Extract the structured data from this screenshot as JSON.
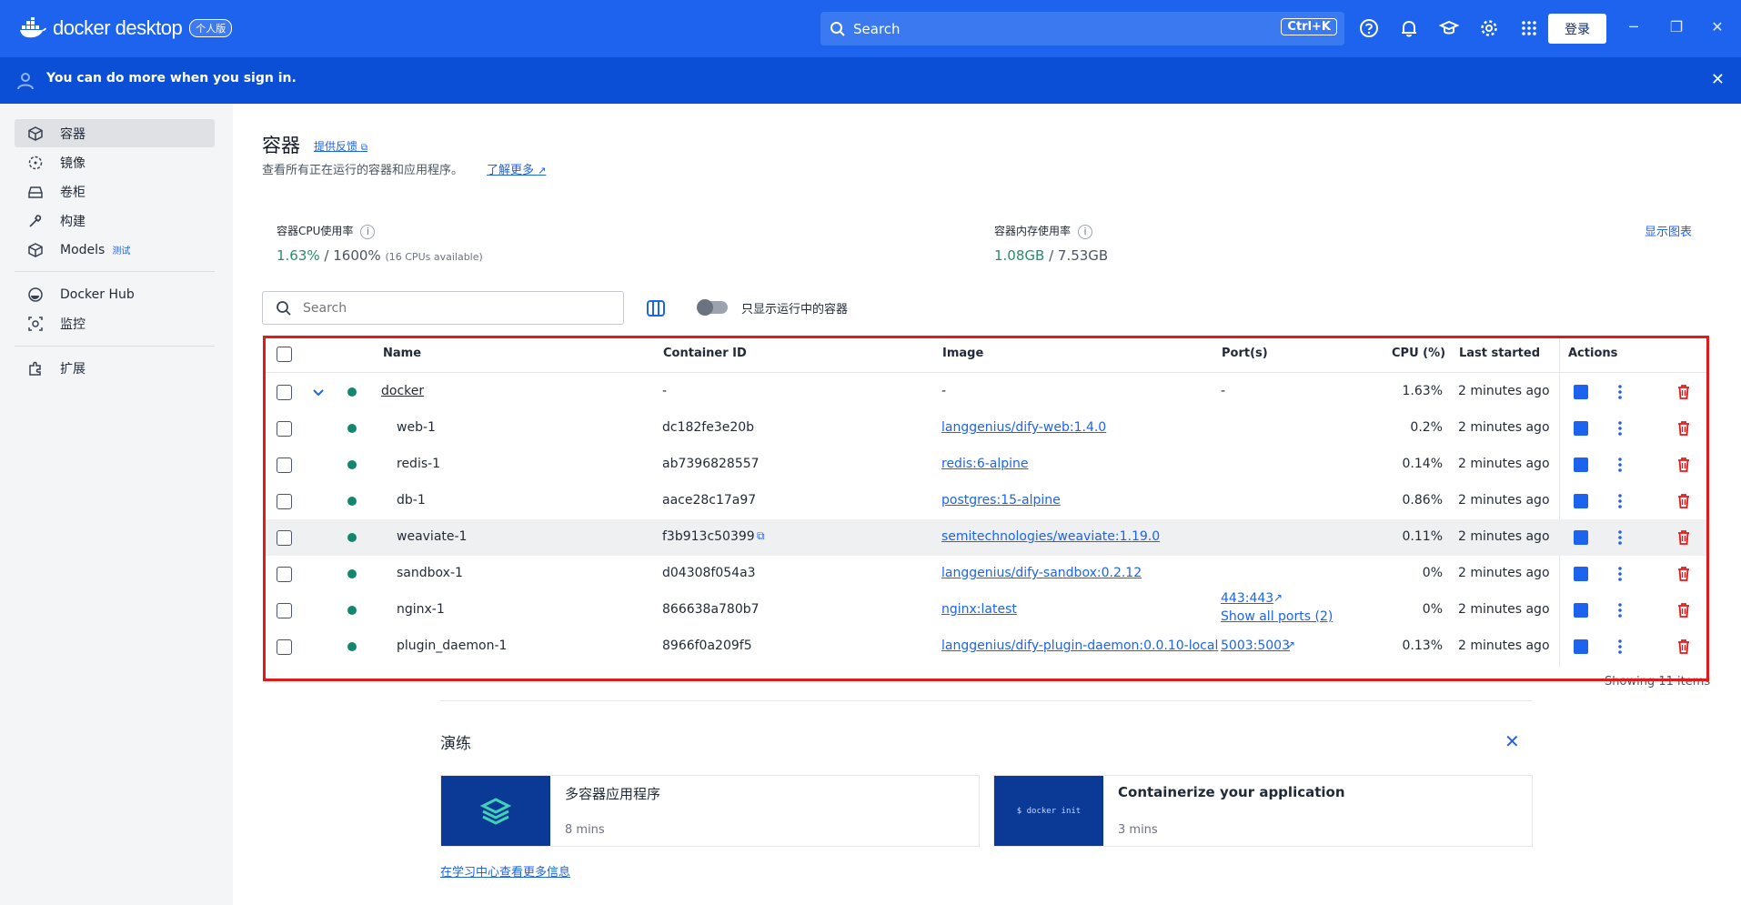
{
  "app": {
    "brand": "docker desktop",
    "edition_badge": "个人版",
    "search_label": "Search",
    "search_shortcut": "Ctrl+K",
    "login_label": "登录",
    "accent_color": "#1d63ed"
  },
  "banner": {
    "text": "You can do more when you sign in.",
    "close_label": "✕"
  },
  "sidebar": {
    "items": [
      {
        "label": "容器",
        "icon": "container-icon",
        "active": true
      },
      {
        "label": "镜像",
        "icon": "images-icon"
      },
      {
        "label": "卷柜",
        "icon": "volumes-icon"
      },
      {
        "label": "构建",
        "icon": "builds-icon"
      },
      {
        "label": "Models",
        "icon": "models-icon",
        "badge": "测试"
      },
      {
        "label": "Docker Hub",
        "icon": "docker-hub-icon"
      },
      {
        "label": "监控",
        "icon": "scout-icon"
      },
      {
        "label": "扩展",
        "icon": "extensions-icon"
      }
    ]
  },
  "header": {
    "title": "容器",
    "feedback_link": "提供反馈",
    "description": "查看所有正在运行的容器和应用程序。",
    "learn_more": "了解更多"
  },
  "stats": {
    "cpu_label": "容器CPU使用率",
    "cpu_used": "1.63%",
    "cpu_total": " / 1600%",
    "cpu_note": "(16 CPUs available)",
    "mem_label": "容器内存使用率",
    "mem_used": "1.08GB",
    "mem_total": " / 7.53GB",
    "show_chart": "显示图表"
  },
  "toolbar": {
    "search_placeholder": "Search",
    "running_only_label": "只显示运行中的容器"
  },
  "table": {
    "headers": {
      "name": "Name",
      "container_id": "Container ID",
      "image": "Image",
      "ports": "Port(s)",
      "cpu": "CPU (%)",
      "last_started": "Last started",
      "actions": "Actions"
    },
    "rows": [
      {
        "name": "docker",
        "id": "-",
        "image": "-",
        "ports": "-",
        "ports2": "",
        "cpu": "1.63%",
        "started": "2 minutes ago"
      },
      {
        "name": "web-1",
        "id": "dc182fe3e20b",
        "image": "langgenius/dify-web:1.4.0",
        "ports": "",
        "ports2": "",
        "cpu": "0.2%",
        "started": "2 minutes ago"
      },
      {
        "name": "redis-1",
        "id": "ab7396828557",
        "image": "redis:6-alpine",
        "ports": "",
        "ports2": "",
        "cpu": "0.14%",
        "started": "2 minutes ago"
      },
      {
        "name": "db-1",
        "id": "aace28c17a97",
        "image": "postgres:15-alpine",
        "ports": "",
        "ports2": "",
        "cpu": "0.86%",
        "started": "2 minutes ago"
      },
      {
        "name": "weaviate-1",
        "id": "f3b913c50399",
        "image": "semitechnologies/weaviate:1.19.0",
        "ports": "",
        "ports2": "",
        "cpu": "0.11%",
        "started": "2 minutes ago"
      },
      {
        "name": "sandbox-1",
        "id": "d04308f054a3",
        "image": "langgenius/dify-sandbox:0.2.12",
        "ports": "",
        "ports2": "",
        "cpu": "0%",
        "started": "2 minutes ago"
      },
      {
        "name": "nginx-1",
        "id": "866638a780b7",
        "image": "nginx:latest",
        "ports": "443:443",
        "ports2": "Show all ports (2)",
        "cpu": "0%",
        "started": "2 minutes ago"
      },
      {
        "name": "plugin_daemon-1",
        "id": "8966f0a209f5",
        "image": "langgenius/dify-plugin-daemon:0.0.10-local",
        "ports": "5003:5003",
        "ports2": "",
        "cpu": "0.13%",
        "started": "2 minutes ago"
      }
    ],
    "showing": "Showing 11 items"
  },
  "walkthroughs": {
    "title": "演练",
    "cards": [
      {
        "name": "多容器应用程序",
        "mins": "8 mins"
      },
      {
        "name": "Containerize your application",
        "mins": "3 mins",
        "thumb_text": "$ docker init"
      }
    ],
    "more_link": "在学习中心查看更多信息"
  }
}
